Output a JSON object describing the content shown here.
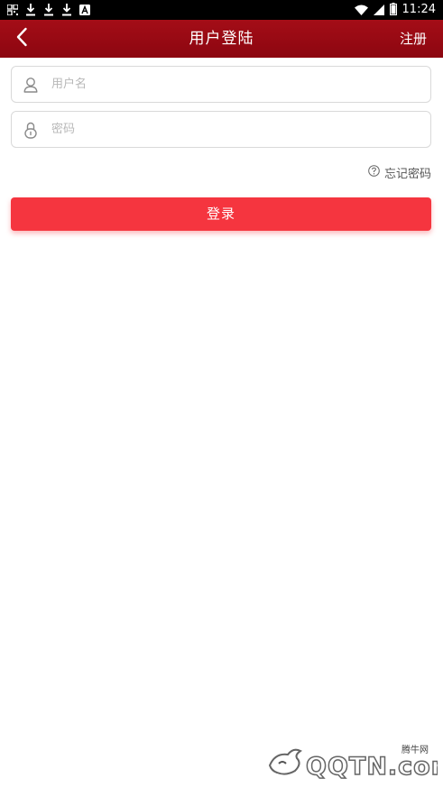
{
  "status_bar": {
    "time": "11:24",
    "left_icons": [
      "qr-code-icon",
      "download-icon",
      "download-icon",
      "download-icon",
      "app-a-icon"
    ],
    "right_icons": [
      "wifi-icon",
      "signal-icon",
      "battery-icon"
    ]
  },
  "nav": {
    "title": "用户登陆",
    "register_label": "注册",
    "back_icon": "chevron-left-icon",
    "bg_color": "#8c0610"
  },
  "form": {
    "username_placeholder": "用户名",
    "username_value": "",
    "username_icon": "user-icon",
    "password_placeholder": "密码",
    "password_value": "",
    "password_icon": "lock-icon",
    "forgot_label": "忘记密码",
    "forgot_icon": "question-circle-icon",
    "login_label": "登录",
    "login_color": "#f5353f"
  },
  "watermark": {
    "cn_text": "腾牛网",
    "en_text": "QQTN.com"
  }
}
